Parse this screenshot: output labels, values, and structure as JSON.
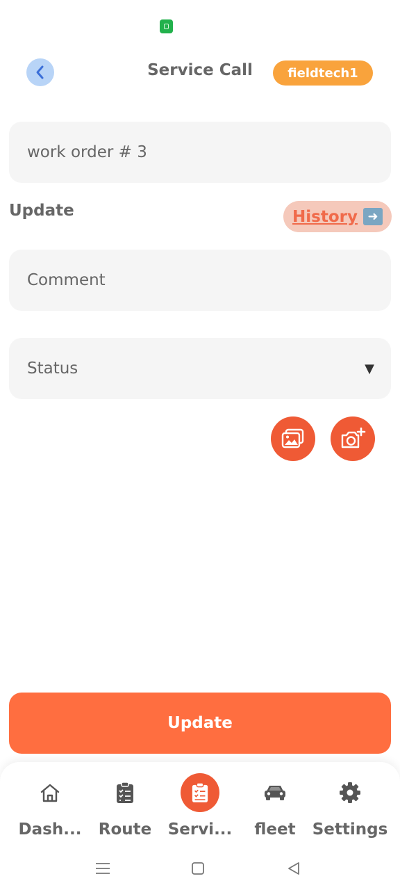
{
  "header": {
    "title": "Service Call",
    "user_badge": "fieldtech1"
  },
  "form": {
    "work_order": "work order # 3",
    "section_label": "Update",
    "history_label": "History",
    "comment_placeholder": "Comment",
    "status_value": "Status",
    "status_caret": "▼",
    "submit_label": "Update"
  },
  "bottom_nav": {
    "items": [
      {
        "label": "Dash...",
        "icon": "home-icon"
      },
      {
        "label": "Route",
        "icon": "clipboard-check-icon"
      },
      {
        "label": "Servi...",
        "icon": "clipboard-list-icon",
        "active": true
      },
      {
        "label": "fleet",
        "icon": "car-icon"
      },
      {
        "label": "Settings",
        "icon": "gear-icon"
      }
    ]
  },
  "colors": {
    "accent": "#ff6e40",
    "badge": "#f9a33c",
    "back_button": "#b8d4f7",
    "history_bg": "#f5c9bb"
  }
}
